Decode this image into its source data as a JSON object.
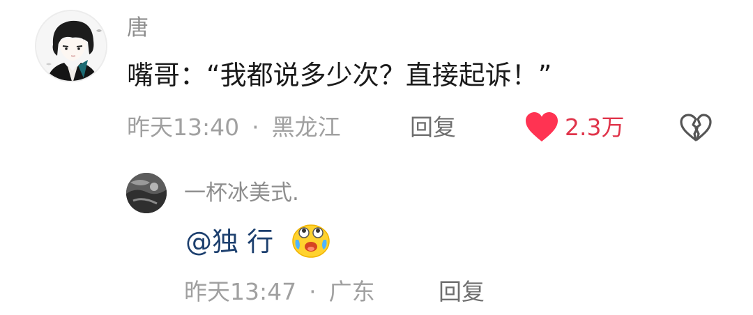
{
  "comment": {
    "username": "唐",
    "text": "嘴哥：“我都说多少次？直接起诉！”",
    "time": "昨天13:40",
    "separator": "·",
    "location": "黑龙江",
    "reply_label": "回复",
    "likes": "2.3万",
    "liked": true,
    "like_color": "#ff3352",
    "icons": {
      "like": "heart-icon",
      "dislike": "broken-heart-icon"
    }
  },
  "reply": {
    "username": "一杯冰美式.",
    "mention": "@独 行",
    "emoji": "crying-laughing-emoji",
    "time": "昨天13:47",
    "separator": "·",
    "location": "广东",
    "reply_label": "回复"
  }
}
